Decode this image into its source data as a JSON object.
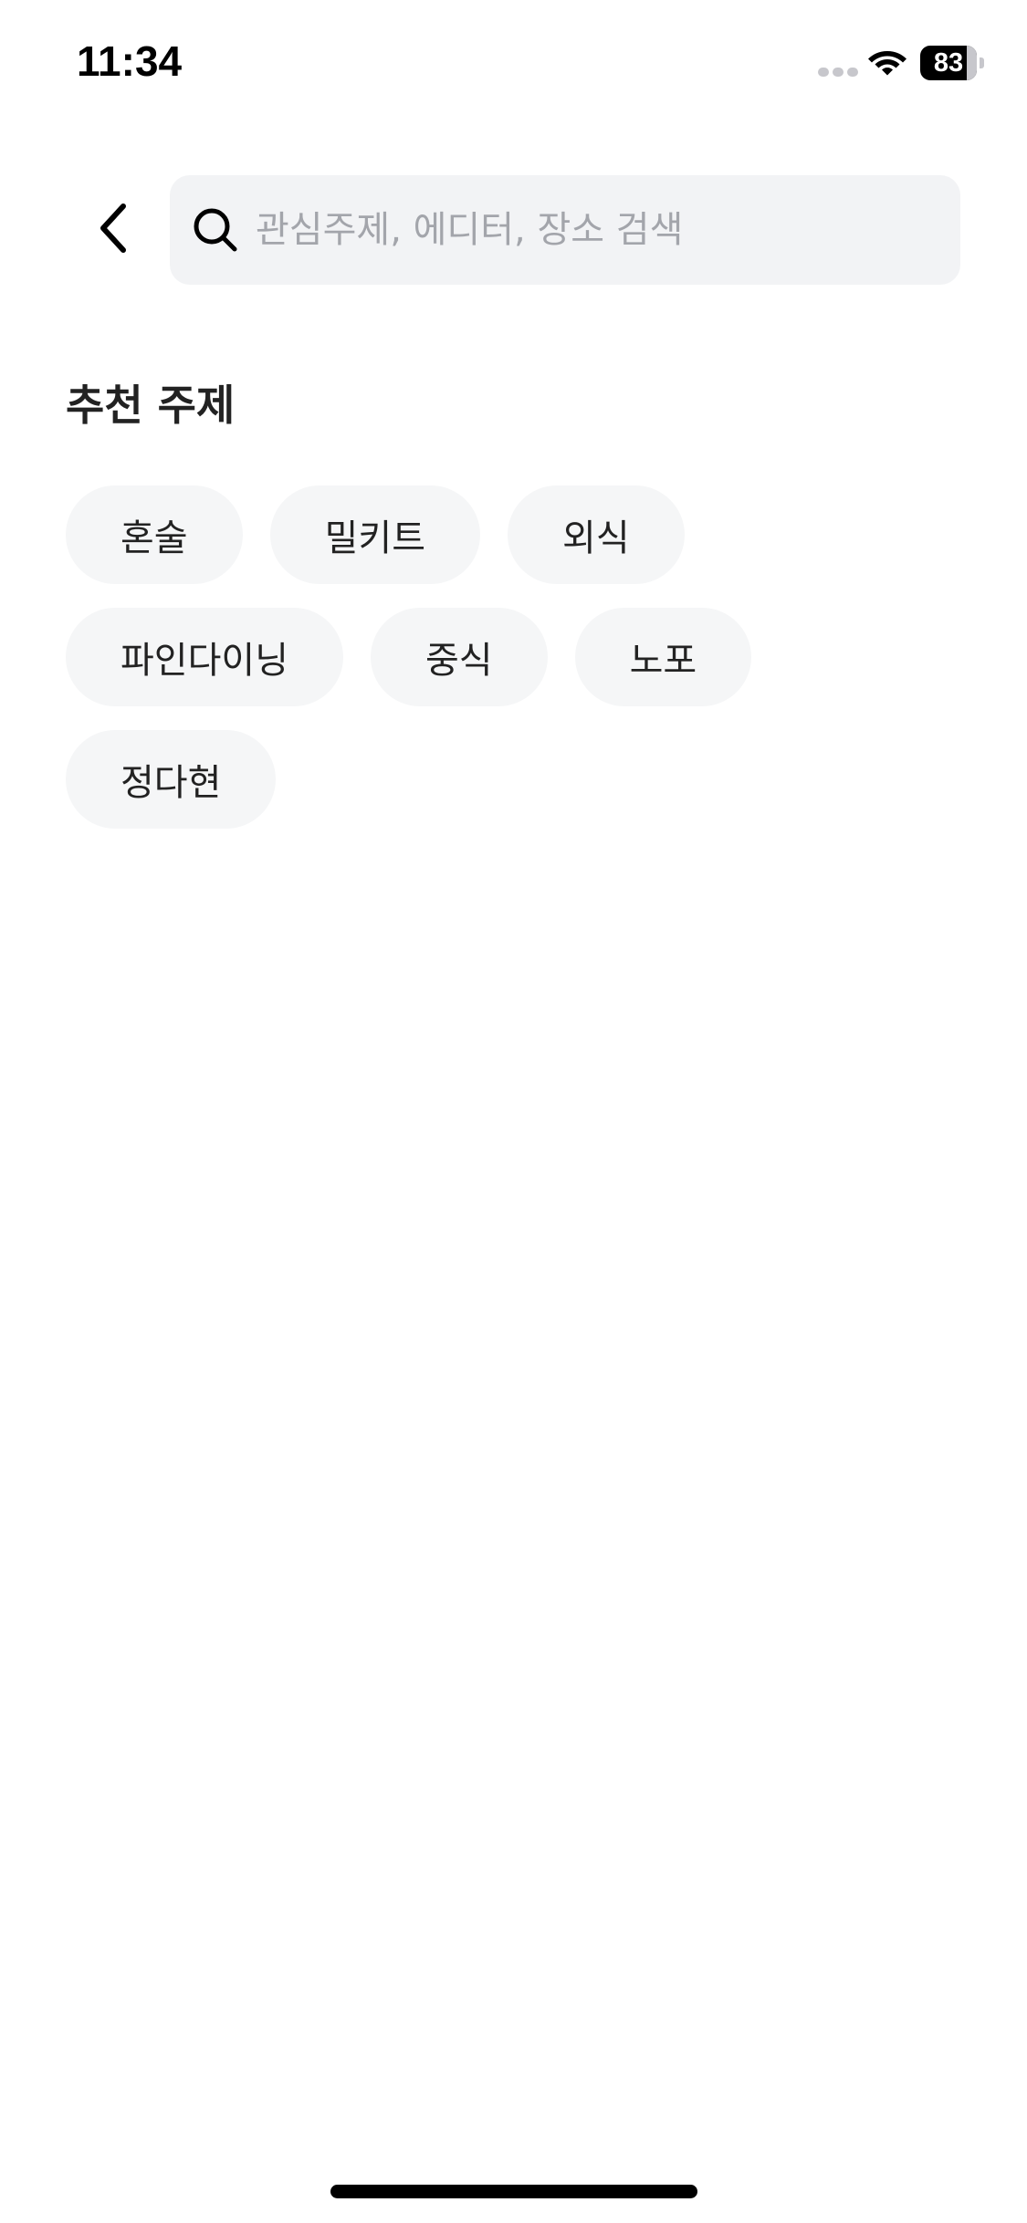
{
  "status_bar": {
    "time": "11:34",
    "battery_level": "83",
    "battery_fraction": 0.83
  },
  "header": {
    "back_icon": "chevron-left-icon",
    "search": {
      "icon": "search-icon",
      "value": "",
      "placeholder": "관심주제, 에디터, 장소 검색"
    }
  },
  "recommended": {
    "title": "추천 주제",
    "topics": [
      {
        "label": "혼술"
      },
      {
        "label": "밀키트"
      },
      {
        "label": "외식"
      },
      {
        "label": "파인다이닝"
      },
      {
        "label": "중식"
      },
      {
        "label": "노포"
      },
      {
        "label": "정다현"
      }
    ]
  },
  "colors": {
    "search_background": "#f2f3f5",
    "chip_background": "#f5f6f7",
    "placeholder_text": "#a3a5ab"
  }
}
